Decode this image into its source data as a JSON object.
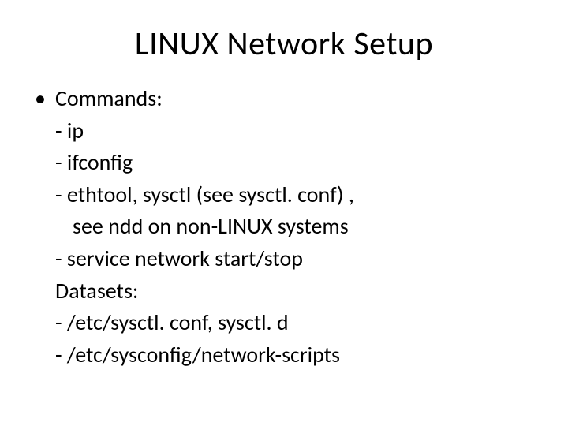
{
  "title": "LINUX Network Setup",
  "bullet_label": "Commands:",
  "lines": {
    "l1": "- ip",
    "l2": "- ifconfig",
    "l3": "- ethtool, sysctl (see sysctl. conf) ,",
    "l4": "see ndd  on non-LINUX systems",
    "l5": "- service network start/stop",
    "l6": "Datasets:",
    "l7": "- /etc/sysctl. conf, sysctl. d",
    "l8": "- /etc/sysconfig/network-scripts"
  }
}
